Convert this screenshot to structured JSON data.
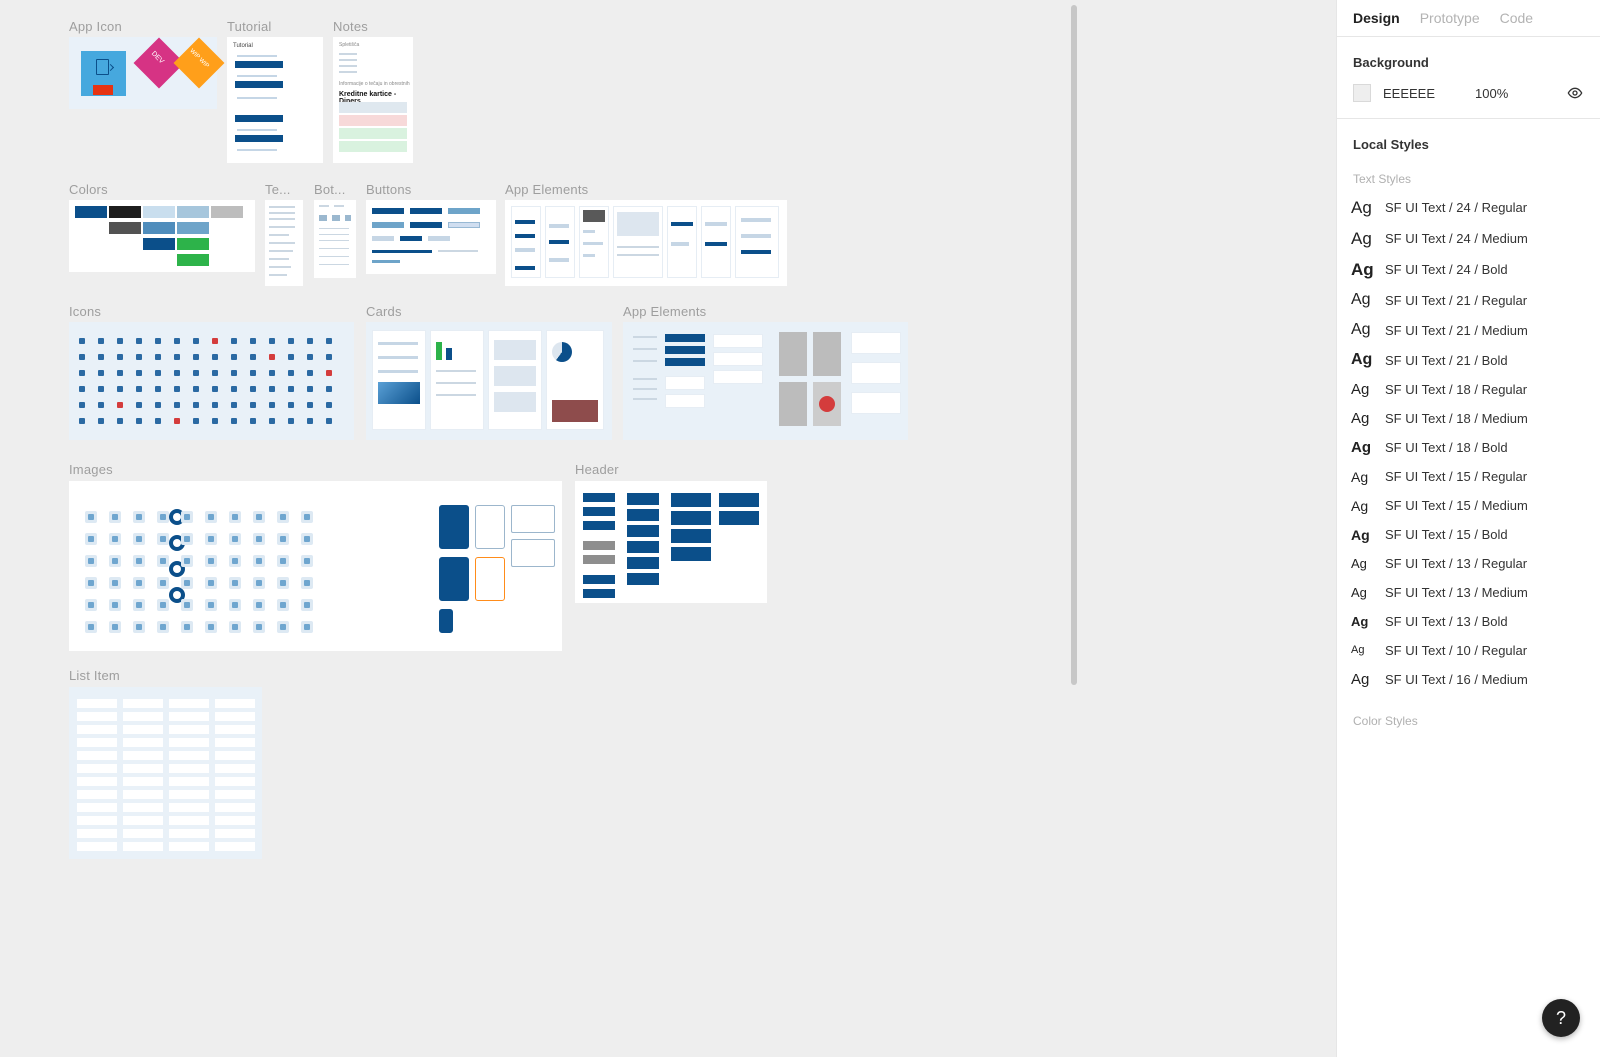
{
  "tabs": {
    "design": "Design",
    "prototype": "Prototype",
    "code": "Code"
  },
  "background": {
    "label": "Background",
    "hex": "EEEEEE",
    "opacity": "100%"
  },
  "local_styles": {
    "label": "Local Styles",
    "text_styles_label": "Text Styles",
    "color_styles_label": "Color Styles",
    "text_styles": [
      {
        "size": 17,
        "weight": 400,
        "name": "SF UI Text / 24 / Regular"
      },
      {
        "size": 17,
        "weight": 500,
        "name": "SF UI Text / 24 / Medium"
      },
      {
        "size": 17,
        "weight": 700,
        "name": "SF UI Text / 24 / Bold"
      },
      {
        "size": 16,
        "weight": 400,
        "name": "SF UI Text / 21 / Regular"
      },
      {
        "size": 16,
        "weight": 500,
        "name": "SF UI Text / 21 / Medium"
      },
      {
        "size": 16,
        "weight": 700,
        "name": "SF UI Text / 21 / Bold"
      },
      {
        "size": 15,
        "weight": 400,
        "name": "SF UI Text / 18 / Regular"
      },
      {
        "size": 15,
        "weight": 500,
        "name": "SF UI Text / 18 / Medium"
      },
      {
        "size": 15,
        "weight": 700,
        "name": "SF UI Text / 18 / Bold"
      },
      {
        "size": 14,
        "weight": 400,
        "name": "SF UI Text / 15 / Regular"
      },
      {
        "size": 14,
        "weight": 500,
        "name": "SF UI Text / 15 / Medium"
      },
      {
        "size": 14,
        "weight": 700,
        "name": "SF UI Text / 15 / Bold"
      },
      {
        "size": 13,
        "weight": 400,
        "name": "SF UI Text / 13 / Regular"
      },
      {
        "size": 13,
        "weight": 500,
        "name": "SF UI Text / 13 / Medium"
      },
      {
        "size": 13,
        "weight": 700,
        "name": "SF UI Text / 13 / Bold"
      },
      {
        "size": 11,
        "weight": 400,
        "name": "SF UI Text / 10 / Regular"
      },
      {
        "size": 15,
        "weight": 500,
        "name": "SF UI Text / 16 / Medium"
      }
    ]
  },
  "frames": {
    "app_icon": "App Icon",
    "tutorial": "Tutorial",
    "notes": "Notes",
    "colors": "Colors",
    "te": "Te...",
    "bot": "Bot...",
    "buttons": "Buttons",
    "app_elements": "App Elements",
    "icons": "Icons",
    "cards": "Cards",
    "app_elements2": "App Elements",
    "images": "Images",
    "header": "Header",
    "list_item": "List Item"
  },
  "notes_content": {
    "title": "Kreditne kartice - Diners"
  },
  "help": "?"
}
